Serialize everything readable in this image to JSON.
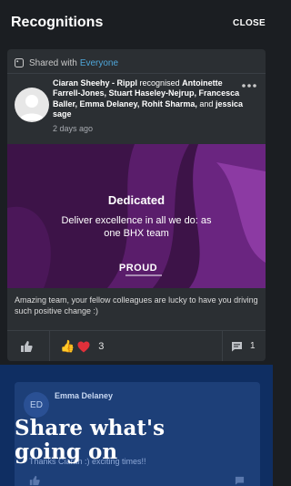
{
  "header": {
    "title": "Recognitions",
    "close_label": "CLOSE"
  },
  "post": {
    "shared_prefix": "Shared with",
    "shared_audience": "Everyone",
    "author": "Ciaran Sheehy - Rippl",
    "verb": "recognised",
    "recipients": "Antoinette Farrell-Jones, Stuart Haseley-Nejrup, Francesca Baller, Emma Delaney, Rohit Sharma,",
    "joiner": "and",
    "last_recipient": "jessica sage",
    "timestamp": "2 days ago",
    "banner": {
      "title": "Dedicated",
      "subtitle": "Deliver excellence in all we do: as one BHX team",
      "logo_text": "PROUD"
    },
    "message": "Amazing team, your fellow colleagues are lucky to have you driving such positive change :)",
    "reactions": {
      "emoji": "👍",
      "count": "3"
    },
    "comment_count": "1",
    "colors": {
      "accent": "#4fa6d9",
      "banner_bg": "#3d1348",
      "heart": "#e0303a"
    }
  },
  "comment_preview": {
    "avatar_initials": "ED",
    "author": "Emma Delaney",
    "text": "Thanks Ciaran :) exciting times!!"
  },
  "promo": {
    "headline": "Share what's going on"
  }
}
